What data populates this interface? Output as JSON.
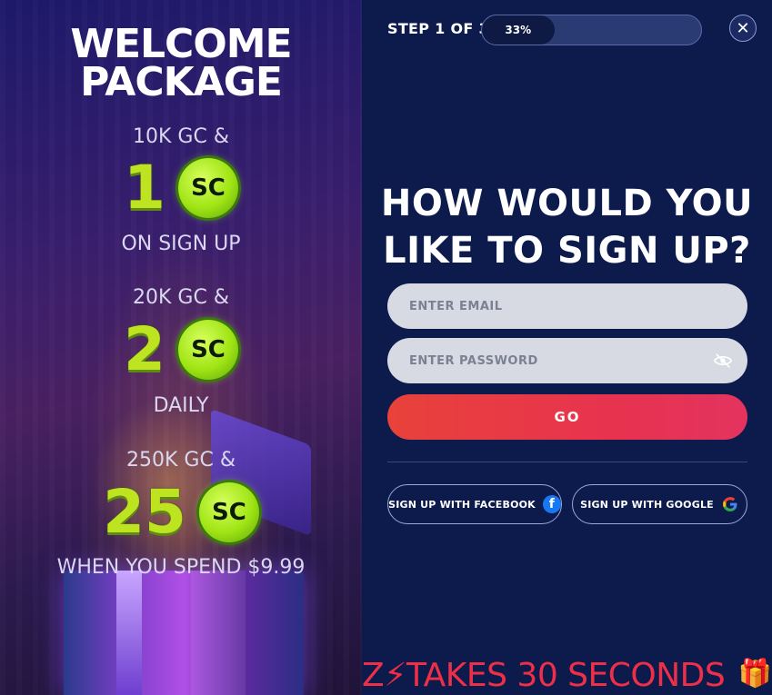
{
  "promo": {
    "title_line1": "WELCOME",
    "title_line2": "PACKAGE",
    "tier1": {
      "top": "10K GC &",
      "number": "1",
      "coin": "SC",
      "bottom": "ON SIGN UP"
    },
    "tier2": {
      "top": "20K GC &",
      "number": "2",
      "coin": "SC",
      "bottom": "DAILY"
    },
    "tier3": {
      "top": "250K GC &",
      "number": "25",
      "coin": "SC",
      "bottom": "WHEN YOU SPEND $9.99"
    }
  },
  "header": {
    "step_label": "STEP 1 OF 3",
    "progress_text": "33%",
    "progress_value": 0.33,
    "close_icon": "close-icon"
  },
  "form": {
    "heading_line1": "HOW WOULD YOU",
    "heading_line2": "LIKE TO SIGN UP?",
    "email_placeholder": "ENTER EMAIL",
    "password_placeholder": "ENTER PASSWORD",
    "password_toggle_icon": "eye-slash-icon",
    "go_label": "GO",
    "facebook_label": "SIGN UP WITH FACEBOOK",
    "google_label": "SIGN UP WITH GOOGLE"
  },
  "banner": {
    "text": "Z⚡TAKES 30 SECONDS",
    "gift": "🎁"
  },
  "colors": {
    "accent_green": "#bde321",
    "go_red": "#e8423a",
    "panel_bg": "#0d1b4c",
    "banner_red": "#ef2f47"
  }
}
